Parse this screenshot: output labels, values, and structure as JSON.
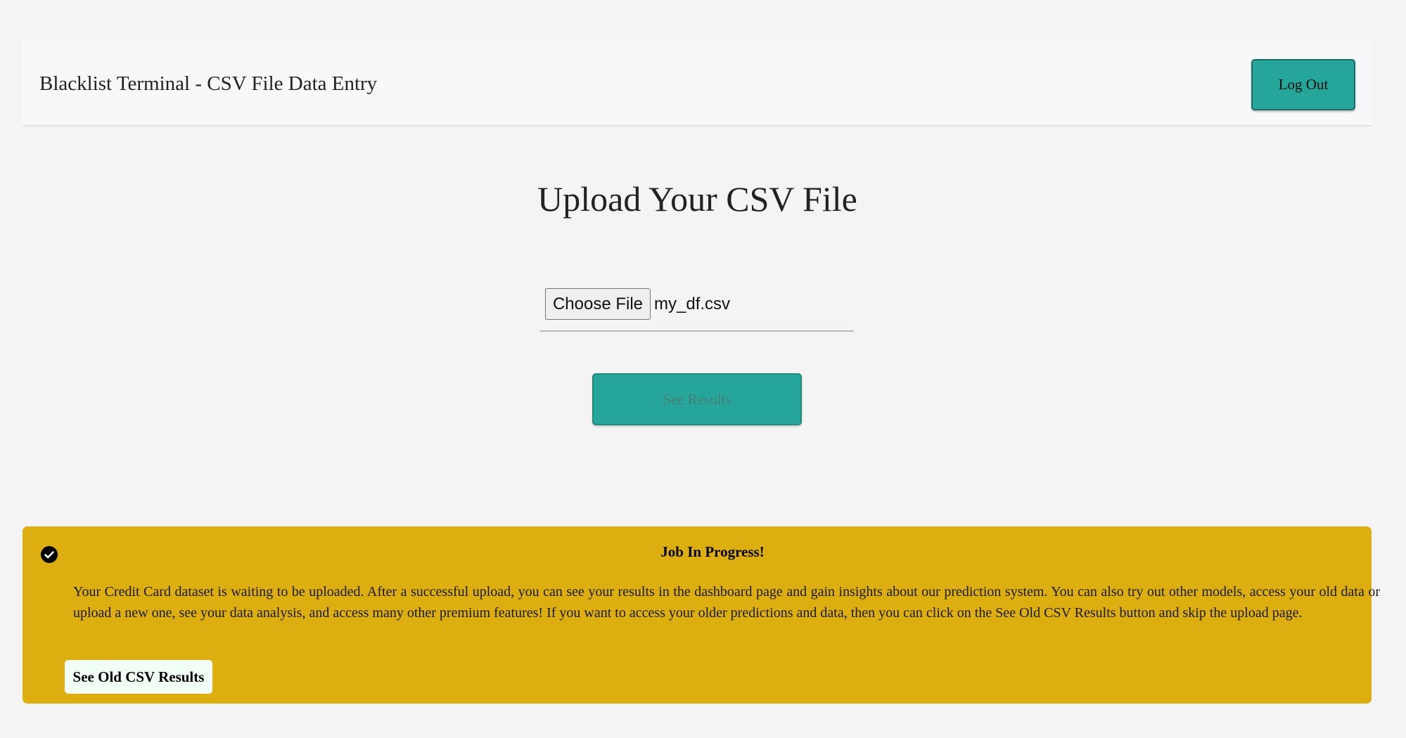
{
  "navbar": {
    "brand": "Blacklist Terminal - CSV File Data Entry",
    "logout_label": "Log Out"
  },
  "upload": {
    "title": "Upload Your CSV File",
    "choose_file_label": "Choose File",
    "selected_file": "my_df.csv",
    "submit_label": "See Results"
  },
  "alert": {
    "icon": "check-circle-icon",
    "title": "Job In Progress!",
    "message": "Your Credit Card dataset is waiting to be uploaded. After a successful upload, you can see your results in the dashboard page and gain insights about our prediction system. You can also try out other models, access your old data or upload a new one, see your data analysis, and access many other premium features! If you want to access your older predictions and data, then you can click on the See Old CSV Results button and skip the upload page.",
    "button_label": "See Old CSV Results"
  },
  "colors": {
    "page_background": "#f4f4f4",
    "navbar_background": "#f7f8f9",
    "accent_teal": "#26a69a",
    "alert_background": "#ddae10",
    "alert_button_background": "#f1fff6"
  }
}
